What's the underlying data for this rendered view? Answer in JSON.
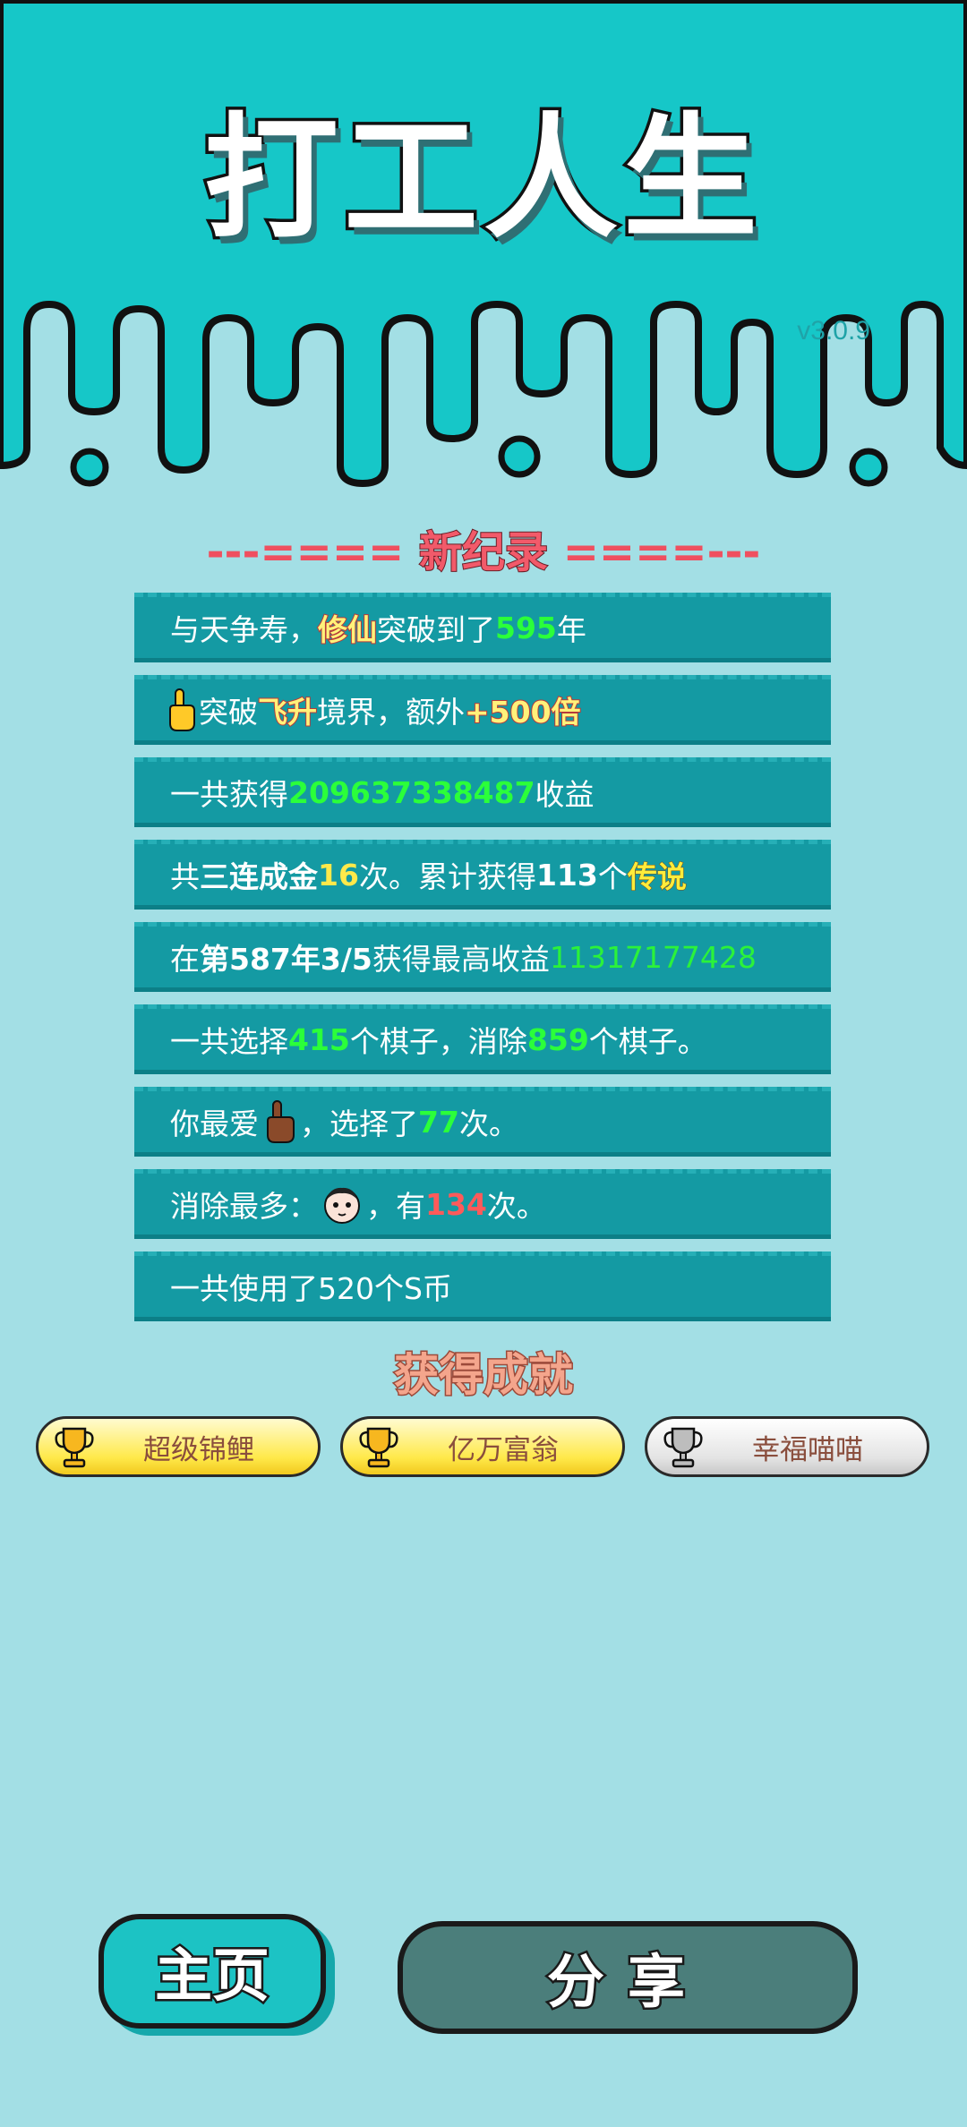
{
  "app": {
    "title": "打工人生",
    "version": "v3.0.9"
  },
  "record": {
    "header_left": "---==== ",
    "header_title": "新纪录",
    "header_right": " ====---"
  },
  "stats": {
    "line1": {
      "a": "与天争寿，",
      "realm": "修仙",
      "b": "突破到了",
      "years": "595",
      "c": "年"
    },
    "line2": {
      "icon": "pointing-hand-icon",
      "a": "突破",
      "realm": "飞升",
      "b": "境界，额外",
      "bonus": "+500倍"
    },
    "line3": {
      "a": "一共获得",
      "total": "209637338487",
      "b": "收益"
    },
    "line4": {
      "a": "共",
      "combo": "三连成金",
      "count": "16",
      "b": "次。累计获得",
      "legend_count": "113",
      "c": "个",
      "legend": "传说"
    },
    "line5": {
      "a": "在 ",
      "date": "第587年3/5",
      "b": " 获得最高收益",
      "max": "11317177428"
    },
    "line6": {
      "a": "一共选择",
      "selected": "415",
      "b": "个棋子，消除",
      "eliminated": "859",
      "c": "个棋子。"
    },
    "line7": {
      "a": "你最爱",
      "icon": "brown-hand-icon",
      "b": "，选择了",
      "times": "77",
      "c": "次。"
    },
    "line8": {
      "a": "消除最多：",
      "icon": "face-icon",
      "b": "，有",
      "times": "134",
      "c": "次。"
    },
    "line9": {
      "a": "一共使用了520个S币"
    }
  },
  "achievements": {
    "title": "获得成就",
    "items": [
      {
        "label": "超级锦鲤",
        "icon": "gold-trophy-icon",
        "tier": "gold"
      },
      {
        "label": "亿万富翁",
        "icon": "gold-trophy-icon",
        "tier": "gold"
      },
      {
        "label": "幸福喵喵",
        "icon": "silver-trophy-icon",
        "tier": "silver"
      }
    ]
  },
  "buttons": {
    "home": "主页",
    "share": "分享"
  },
  "colors": {
    "background": "#a3dfe5",
    "header": "#16c7c8",
    "stat_row": "#149aa3",
    "highlight_green": "#2bff3a",
    "highlight_yellow": "#ffe94a",
    "highlight_red": "#ff5a5a"
  }
}
